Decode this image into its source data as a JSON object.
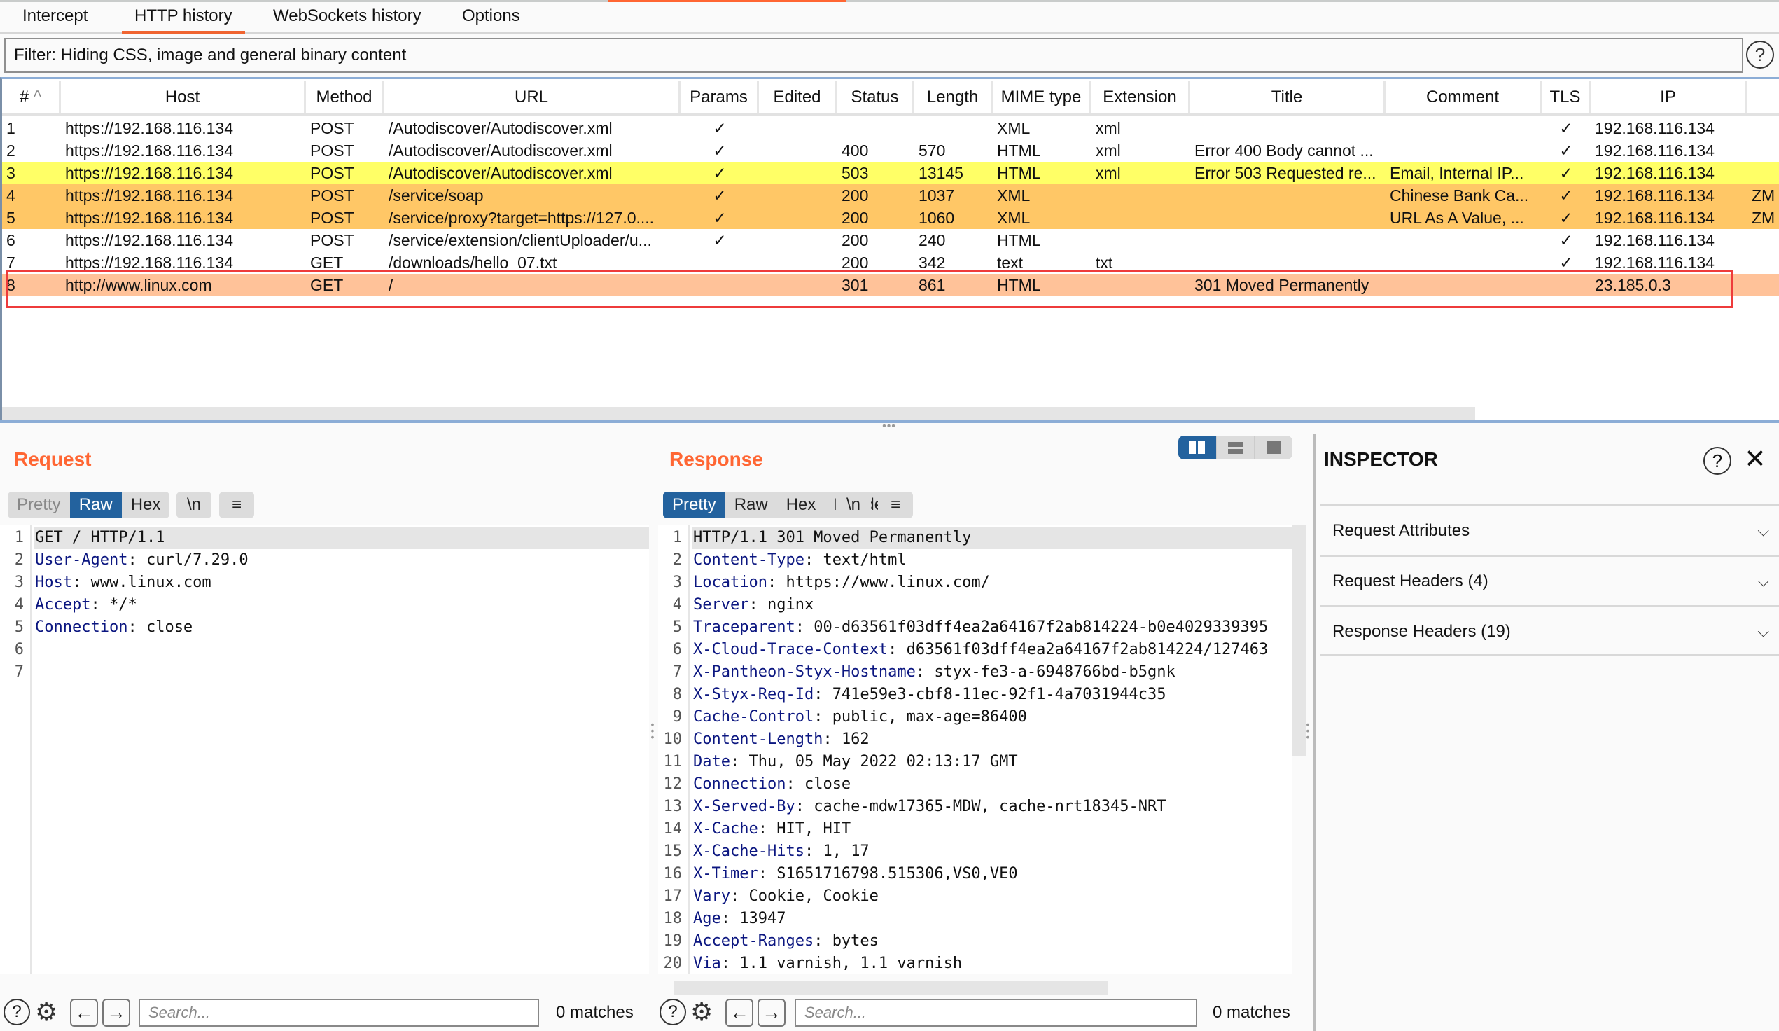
{
  "tabs": [
    {
      "label": "Intercept",
      "active": false
    },
    {
      "label": "HTTP history",
      "active": true
    },
    {
      "label": "WebSockets history",
      "active": false
    },
    {
      "label": "Options",
      "active": false
    }
  ],
  "filter": {
    "text": "Filter: Hiding CSS, image and general binary content"
  },
  "table": {
    "columns": [
      "#",
      "Host",
      "Method",
      "URL",
      "Params",
      "Edited",
      "Status",
      "Length",
      "MIME type",
      "Extension",
      "Title",
      "Comment",
      "TLS",
      "IP",
      ""
    ],
    "sort_indicator": "^",
    "rows": [
      {
        "num": "1",
        "host": "https://192.168.116.134",
        "method": "POST",
        "url": "/Autodiscover/Autodiscover.xml",
        "params": "✓",
        "edited": "",
        "status": "",
        "length": "",
        "mime": "XML",
        "ext": "xml",
        "title": "",
        "comment": "",
        "tls": "✓",
        "ip": "192.168.116.134",
        "extra": "",
        "color": "#ffffff"
      },
      {
        "num": "2",
        "host": "https://192.168.116.134",
        "method": "POST",
        "url": "/Autodiscover/Autodiscover.xml",
        "params": "✓",
        "edited": "",
        "status": "400",
        "length": "570",
        "mime": "HTML",
        "ext": "xml",
        "title": "Error 400 Body cannot ...",
        "comment": "",
        "tls": "✓",
        "ip": "192.168.116.134",
        "extra": "",
        "color": "#ffffff"
      },
      {
        "num": "3",
        "host": "https://192.168.116.134",
        "method": "POST",
        "url": "/Autodiscover/Autodiscover.xml",
        "params": "✓",
        "edited": "",
        "status": "503",
        "length": "13145",
        "mime": "HTML",
        "ext": "xml",
        "title": "Error 503 Requested re...",
        "comment": "Email, Internal IP...",
        "tls": "✓",
        "ip": "192.168.116.134",
        "extra": "",
        "color": "#ffff66"
      },
      {
        "num": "4",
        "host": "https://192.168.116.134",
        "method": "POST",
        "url": "/service/soap",
        "params": "✓",
        "edited": "",
        "status": "200",
        "length": "1037",
        "mime": "XML",
        "ext": "",
        "title": "",
        "comment": "Chinese Bank Ca...",
        "tls": "✓",
        "ip": "192.168.116.134",
        "extra": "ZM",
        "color": "#ffc766"
      },
      {
        "num": "5",
        "host": "https://192.168.116.134",
        "method": "POST",
        "url": "/service/proxy?target=https://127.0....",
        "params": "✓",
        "edited": "",
        "status": "200",
        "length": "1060",
        "mime": "XML",
        "ext": "",
        "title": "",
        "comment": "URL As A Value, ...",
        "tls": "✓",
        "ip": "192.168.116.134",
        "extra": "ZM",
        "color": "#ffc766"
      },
      {
        "num": "6",
        "host": "https://192.168.116.134",
        "method": "POST",
        "url": "/service/extension/clientUploader/u...",
        "params": "✓",
        "edited": "",
        "status": "200",
        "length": "240",
        "mime": "HTML",
        "ext": "",
        "title": "",
        "comment": "",
        "tls": "✓",
        "ip": "192.168.116.134",
        "extra": "",
        "color": "#ffffff"
      },
      {
        "num": "7",
        "host": "https://192.168.116.134",
        "method": "GET",
        "url": "/downloads/hello_07.txt",
        "params": "",
        "edited": "",
        "status": "200",
        "length": "342",
        "mime": "text",
        "ext": "txt",
        "title": "",
        "comment": "",
        "tls": "✓",
        "ip": "192.168.116.134",
        "extra": "",
        "color": "#ffffff"
      },
      {
        "num": "8",
        "host": "http://www.linux.com",
        "method": "GET",
        "url": "/",
        "params": "",
        "edited": "",
        "status": "301",
        "length": "861",
        "mime": "HTML",
        "ext": "",
        "title": "301 Moved Permanently",
        "comment": "",
        "tls": "",
        "ip": "23.185.0.3",
        "extra": "",
        "color": "#ffc299"
      }
    ]
  },
  "request": {
    "title": "Request",
    "view_tabs": [
      "Pretty",
      "Raw",
      "Hex"
    ],
    "active_view": "Raw",
    "newline_btn": "\\n",
    "menu_icon": "≡",
    "lines": [
      {
        "key": "",
        "value": "GET / HTTP/1.1"
      },
      {
        "key": "User-Agent",
        "value": "curl/7.29.0"
      },
      {
        "key": "Host",
        "value": "www.linux.com"
      },
      {
        "key": "Accept",
        "value": "*/*"
      },
      {
        "key": "Connection",
        "value": "close"
      },
      {
        "key": "",
        "value": ""
      },
      {
        "key": "",
        "value": ""
      }
    ],
    "search_placeholder": "Search...",
    "matches": "0 matches"
  },
  "response": {
    "title": "Response",
    "view_tabs": [
      "Pretty",
      "Raw",
      "Hex",
      "Render"
    ],
    "active_view": "Pretty",
    "newline_btn": "\\n",
    "menu_icon": "≡",
    "lines": [
      {
        "key": "",
        "value": "HTTP/1.1 301 Moved Permanently"
      },
      {
        "key": "Content-Type",
        "value": "text/html"
      },
      {
        "key": "Location",
        "value": "https://www.linux.com/"
      },
      {
        "key": "Server",
        "value": "nginx"
      },
      {
        "key": "Traceparent",
        "value": "00-d63561f03dff4ea2a64167f2ab814224-b0e4029339395"
      },
      {
        "key": "X-Cloud-Trace-Context",
        "value": "d63561f03dff4ea2a64167f2ab814224/127463"
      },
      {
        "key": "X-Pantheon-Styx-Hostname",
        "value": "styx-fe3-a-6948766bd-b5gnk"
      },
      {
        "key": "X-Styx-Req-Id",
        "value": "741e59e3-cbf8-11ec-92f1-4a7031944c35"
      },
      {
        "key": "Cache-Control",
        "value": "public, max-age=86400"
      },
      {
        "key": "Content-Length",
        "value": "162"
      },
      {
        "key": "Date",
        "value": "Thu, 05 May 2022 02:13:17 GMT"
      },
      {
        "key": "Connection",
        "value": "close"
      },
      {
        "key": "X-Served-By",
        "value": "cache-mdw17365-MDW, cache-nrt18345-NRT"
      },
      {
        "key": "X-Cache",
        "value": "HIT, HIT"
      },
      {
        "key": "X-Cache-Hits",
        "value": "1, 17"
      },
      {
        "key": "X-Timer",
        "value": "S1651716798.515306,VS0,VE0"
      },
      {
        "key": "Vary",
        "value": "Cookie, Cookie"
      },
      {
        "key": "Age",
        "value": "13947"
      },
      {
        "key": "Accept-Ranges",
        "value": "bytes"
      },
      {
        "key": "Via",
        "value": "1.1 varnish, 1.1 varnish"
      }
    ],
    "search_placeholder": "Search...",
    "matches": "0 matches"
  },
  "inspector": {
    "title": "INSPECTOR",
    "sections": [
      {
        "label": "Request Attributes"
      },
      {
        "label": "Request Headers (4)"
      },
      {
        "label": "Response Headers (19)"
      }
    ]
  },
  "icons": {
    "help": "?",
    "close": "✕",
    "chevron_down": "⌄",
    "arrow_left": "←",
    "arrow_right": "→",
    "gear": "⚙"
  },
  "colors": {
    "accent": "#ff6633",
    "selected_tab": "#23629e",
    "highlight_yellow": "#ffff66",
    "highlight_orange": "#ffc766",
    "highlight_salmon": "#ffc299",
    "selection_box": "#ee3b3b"
  }
}
